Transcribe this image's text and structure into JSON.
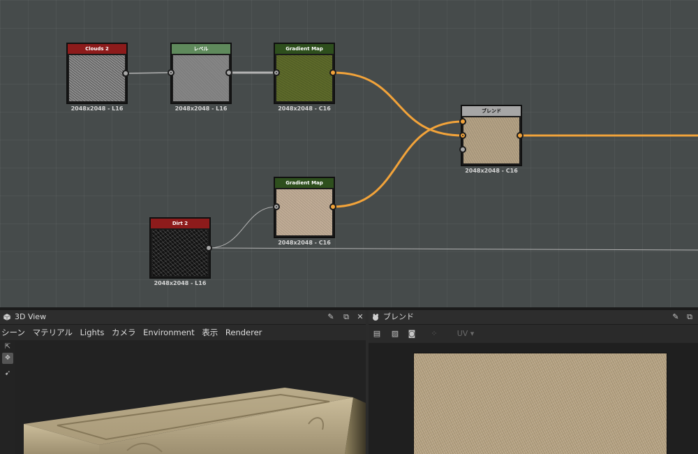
{
  "graph": {
    "nodes": [
      {
        "id": "clouds",
        "title": "Clouds 2",
        "size": "2048x2048 - L16",
        "header_color": "#8d1b1b"
      },
      {
        "id": "levels",
        "title": "レベル",
        "size": "2048x2048 - L16",
        "header_color": "#5f8a5c"
      },
      {
        "id": "gradmap1",
        "title": "Gradient Map",
        "size": "2048x2048 - C16",
        "header_color": "#2e4f1d"
      },
      {
        "id": "blend",
        "title": "ブレンド",
        "size": "2048x2048 - C16",
        "header_color": "#a6a6a6"
      },
      {
        "id": "gradmap2",
        "title": "Gradient Map",
        "size": "2048x2048 - C16",
        "header_color": "#2e4f1d"
      },
      {
        "id": "dirt",
        "title": "Dirt 2",
        "size": "2048x2048 - L16",
        "header_color": "#8d1b1b"
      }
    ],
    "wire_color_active": "#f2a33a",
    "wire_color_inactive": "#b5b5b5"
  },
  "view3d": {
    "title": "3D View",
    "icon": "cube-icon",
    "menu": [
      "シーン",
      "マテリアル",
      "Lights",
      "カメラ",
      "Environment",
      "表示",
      "Renderer"
    ]
  },
  "view2d": {
    "title": "ブレンド",
    "icon": "paint-icon",
    "uv_label": "UV"
  }
}
